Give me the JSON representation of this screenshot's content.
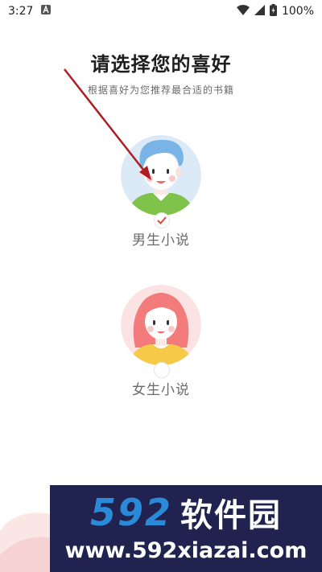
{
  "status_bar": {
    "time": "3:27",
    "battery": "100%",
    "icons": [
      "a-notification-icon",
      "wifi-icon",
      "signal-icon",
      "battery-icon"
    ]
  },
  "page": {
    "title": "请选择您的喜好",
    "subtitle": "根据喜好为您推荐最合适的书籍"
  },
  "preferences": [
    {
      "label": "男生小说",
      "selected": true,
      "avatar": "male-avatar",
      "accent": "#79b4e6",
      "shirt": "#7fc24a"
    },
    {
      "label": "女生小说",
      "selected": false,
      "avatar": "female-avatar",
      "accent": "#f37b7b",
      "shirt": "#f7c948"
    }
  ],
  "watermark": {
    "number": "592",
    "name": "软件园",
    "url": "www.592xiazai.com"
  },
  "colors": {
    "arrow": "#b01c24",
    "check": "#e0483b",
    "watermark_bg": "#20234f",
    "watermark_accent": "#2b8ad8"
  }
}
